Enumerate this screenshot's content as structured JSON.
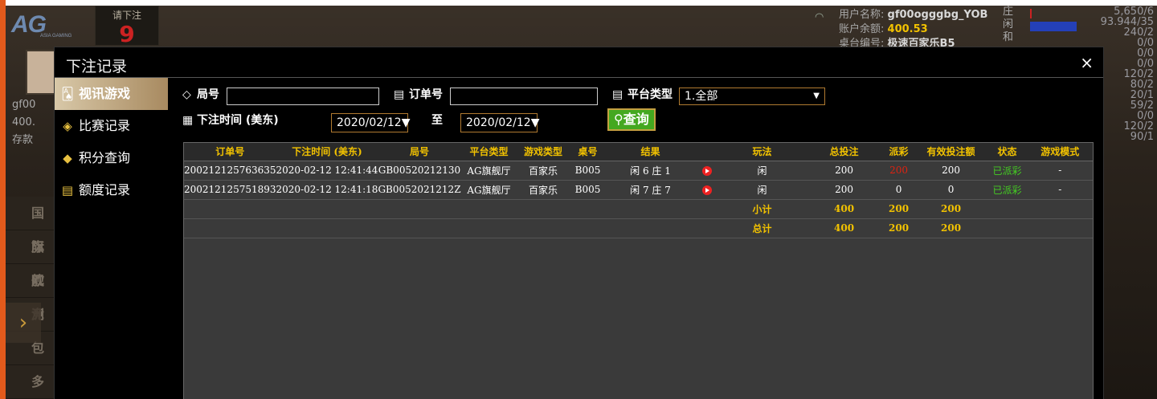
{
  "background": {
    "logo": "AG",
    "logo_sub": "ASIA GAMING",
    "bet_prompt": "请下注",
    "countdown": "9",
    "left_labels": [
      "gf00",
      "400.",
      "存款"
    ],
    "left_menu": [
      "国际",
      "旗舰",
      "欧洲",
      "竞",
      "包",
      "多"
    ],
    "user_label": "用户名称:",
    "user_name": "gf00ogggbg_YOB",
    "balance_label": "账户余额:",
    "balance": "400.53",
    "table_label": "桌台编号:",
    "table_name": "极速百家乐B5",
    "road_labels": [
      "庄",
      "闲",
      "和"
    ],
    "stats": [
      "5,650/6",
      "93.944/35",
      "240/2",
      "0/0",
      "0/0",
      "0/0",
      "120/2",
      "80/2",
      "20/1",
      "59/2",
      "0/0",
      "120/2",
      "90/1"
    ]
  },
  "modal": {
    "title": "下注记录",
    "close": "×"
  },
  "sidebar": {
    "items": [
      {
        "label": "视讯游戏",
        "icon": "cards-icon",
        "glyph": "🂡",
        "active": true
      },
      {
        "label": "比赛记录",
        "icon": "ticket-icon",
        "glyph": "◈",
        "active": false
      },
      {
        "label": "积分查询",
        "icon": "gem-icon",
        "glyph": "◆",
        "active": false
      },
      {
        "label": "额度记录",
        "icon": "document-icon",
        "glyph": "▤",
        "active": false
      }
    ]
  },
  "filters": {
    "round_label": "局号",
    "round_value": "",
    "order_label": "订单号",
    "order_value": "",
    "platform_label": "平台类型",
    "platform_value": "1.全部",
    "time_label": "下注时间 (美东)",
    "date_from": "2020/02/12",
    "to_label": "至",
    "date_to": "2020/02/12",
    "query_label": "查询"
  },
  "table": {
    "headers": [
      "订单号",
      "下注时间 (美东)",
      "局号",
      "平台类型",
      "游戏类型",
      "桌号",
      "结果",
      "",
      "玩法",
      "总投注",
      "派彩",
      "有效投注额",
      "状态",
      "游戏模式"
    ],
    "rows": [
      {
        "order": "200212125763635",
        "time": "2020-02-12 12:41:44",
        "round": "GB00520212130",
        "platform": "AG旗舰厅",
        "game": "百家乐",
        "table": "B005",
        "result": "闲 6 庄 1",
        "play": "闲",
        "bet": "200",
        "payout": "200",
        "valid": "200",
        "status": "已派彩",
        "mode": "-",
        "payout_red": true
      },
      {
        "order": "200212125751893",
        "time": "2020-02-12 12:41:18",
        "round": "GB0052021212Z",
        "platform": "AG旗舰厅",
        "game": "百家乐",
        "table": "B005",
        "result": "闲 7 庄 7",
        "play": "闲",
        "bet": "200",
        "payout": "0",
        "valid": "0",
        "status": "已派彩",
        "mode": "-",
        "payout_red": false
      }
    ],
    "subtotal": {
      "label": "小计",
      "bet": "400",
      "payout": "200",
      "valid": "200"
    },
    "total": {
      "label": "总计",
      "bet": "400",
      "payout": "200",
      "valid": "200"
    }
  }
}
